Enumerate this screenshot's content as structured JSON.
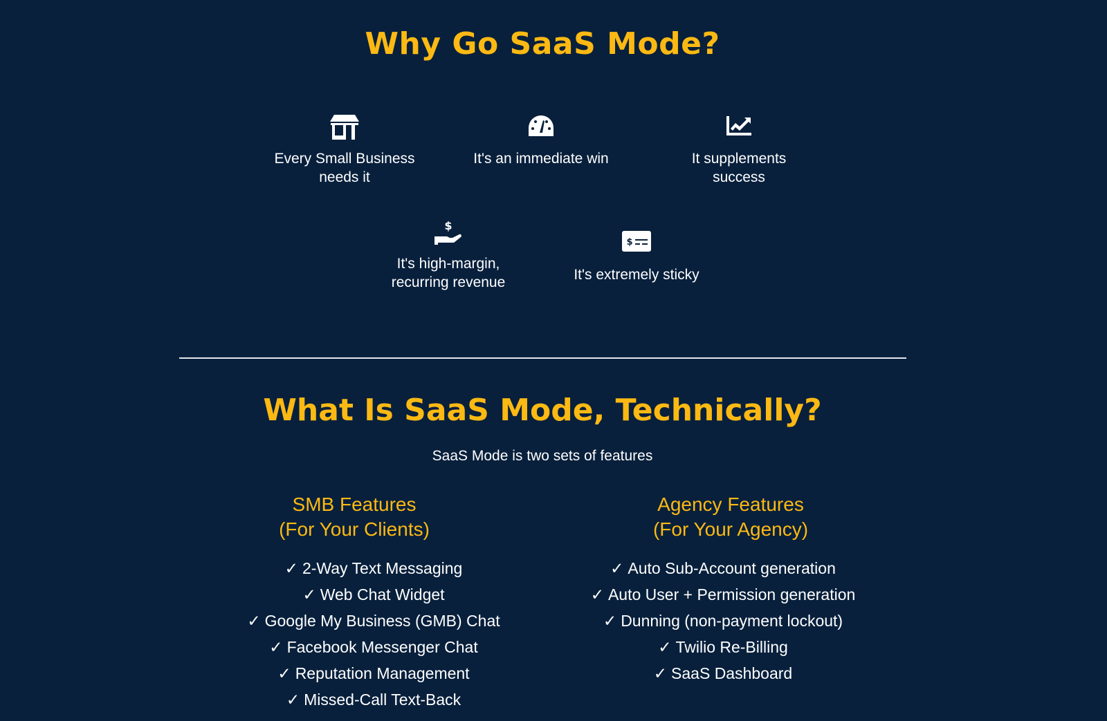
{
  "section1": {
    "title": "Why Go SaaS Mode?",
    "reasons": [
      {
        "icon": "store-icon",
        "line1": "Every Small Business",
        "line2": "needs it"
      },
      {
        "icon": "speedometer-icon",
        "line1": "It's an immediate win",
        "line2": ""
      },
      {
        "icon": "chart-line-icon",
        "line1": "It supplements",
        "line2": "success"
      },
      {
        "icon": "hand-dollar-icon",
        "line1": "It's high-margin,",
        "line2": "recurring revenue"
      },
      {
        "icon": "money-check-icon",
        "line1": "It's extremely sticky",
        "line2": ""
      }
    ]
  },
  "section2": {
    "title": "What Is SaaS Mode, Technically?",
    "subtitle": "SaaS Mode is two sets of features",
    "check": "✓",
    "smb": {
      "title_line1": "SMB Features",
      "title_line2": "(For Your Clients)",
      "items": [
        "2-Way Text Messaging",
        "Web Chat Widget",
        "Google My Business (GMB) Chat",
        "Facebook Messenger Chat",
        "Reputation Management",
        "Missed-Call Text-Back"
      ]
    },
    "agency": {
      "title_line1": "Agency Features",
      "title_line2": "(For Your Agency)",
      "items": [
        "Auto Sub-Account generation",
        "Auto User + Permission generation",
        "Dunning (non-payment lockout)",
        "Twilio Re-Billing",
        "SaaS Dashboard"
      ]
    }
  },
  "colors": {
    "background": "#08203c",
    "accent": "#fdb913",
    "text": "#ffffff"
  }
}
